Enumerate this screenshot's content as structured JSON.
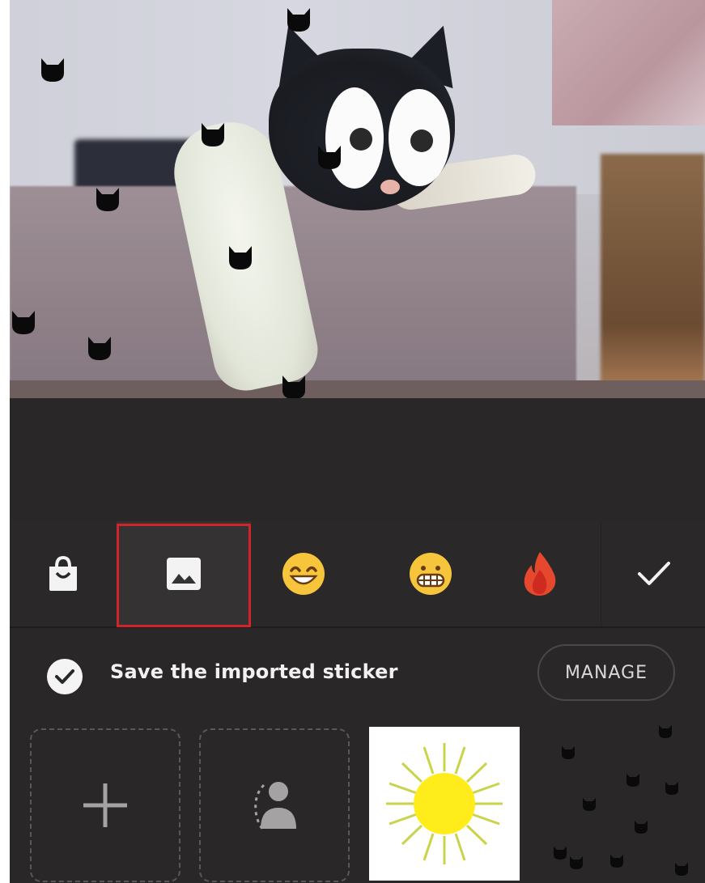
{
  "toolbar": {
    "tools": [
      {
        "name": "sticker-store",
        "icon": "shopping-bag-icon"
      },
      {
        "name": "gallery-import",
        "icon": "image-icon",
        "selected": true
      },
      {
        "name": "emoji-smile",
        "icon": "smiling-face-emoji"
      },
      {
        "name": "emoji-grin",
        "icon": "grimacing-face-emoji"
      },
      {
        "name": "emoji-fire",
        "icon": "fire-emoji"
      }
    ],
    "done_icon": "checkmark-icon",
    "highlight_color": "#d0232a"
  },
  "save_row": {
    "checked": true,
    "label": "Save the imported sticker",
    "manage_label": "MANAGE"
  },
  "grid": {
    "items": [
      {
        "name": "add-sticker",
        "icon": "plus-icon"
      },
      {
        "name": "cutout-person",
        "icon": "person-cutout-icon"
      },
      {
        "name": "sun-sticker",
        "icon": "sun-icon"
      },
      {
        "name": "cats-pattern-sticker",
        "icon": "cat-silhouettes-icon"
      }
    ]
  },
  "colors": {
    "background": "#2a2728",
    "accent_red": "#d0232a",
    "text": "#f1f1f1"
  }
}
